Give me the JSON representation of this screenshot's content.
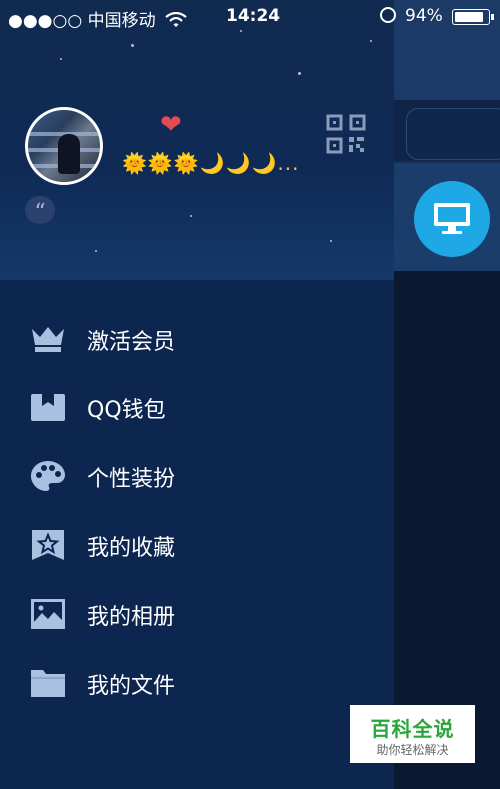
{
  "status_bar": {
    "signal_dots": "●●●○○",
    "carrier": "中国移动",
    "time": "14:24",
    "battery_percent": "94%",
    "battery_level": 0.94
  },
  "profile": {
    "heart": "❤",
    "level_badges": "🌞🌞🌞🌙🌙🌙...",
    "quote_mark": "“"
  },
  "menu": [
    {
      "label": "激活会员",
      "icon": "crown-icon"
    },
    {
      "label": "QQ钱包",
      "icon": "wallet-icon"
    },
    {
      "label": "个性装扮",
      "icon": "palette-icon"
    },
    {
      "label": "我的收藏",
      "icon": "star-bookmark-icon"
    },
    {
      "label": "我的相册",
      "icon": "photo-icon"
    },
    {
      "label": "我的文件",
      "icon": "folder-icon"
    }
  ],
  "watermark": {
    "title": "百科全说",
    "subtitle": "助你轻松解决"
  },
  "colors": {
    "drawer_bg": "#0d2650",
    "icon_color": "#a9c0e0",
    "accent_blue": "#1ea8e6"
  }
}
